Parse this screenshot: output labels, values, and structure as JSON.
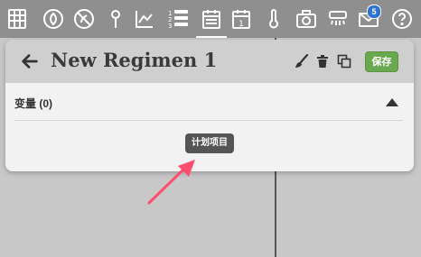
{
  "nav": {
    "icons": [
      {
        "name": "grid-icon"
      },
      {
        "name": "leaf-icon"
      },
      {
        "name": "no-weed-icon"
      },
      {
        "name": "probe-icon"
      },
      {
        "name": "chart-icon"
      },
      {
        "name": "sequence-list-icon",
        "digits": [
          "1",
          "2",
          "3"
        ]
      },
      {
        "name": "regimen-calendar-icon",
        "active": true
      },
      {
        "name": "farm-event-calendar-icon",
        "day": "1"
      },
      {
        "name": "thermometer-icon"
      },
      {
        "name": "camera-icon"
      },
      {
        "name": "sprinkler-icon"
      },
      {
        "name": "messages-icon",
        "badge": "5"
      },
      {
        "name": "help-icon"
      }
    ],
    "badge_color": "#2c73d2"
  },
  "panel": {
    "title": "New Regimen 1",
    "save_label": "保存",
    "section_label": "变量 (0)",
    "tooltip_text": "计划项目"
  },
  "colors": {
    "save_green": "#6aa84f",
    "pointer_red": "#ff4d6d",
    "nav_bg": "#8f8f8f",
    "panel_header": "#cfcfcf"
  }
}
